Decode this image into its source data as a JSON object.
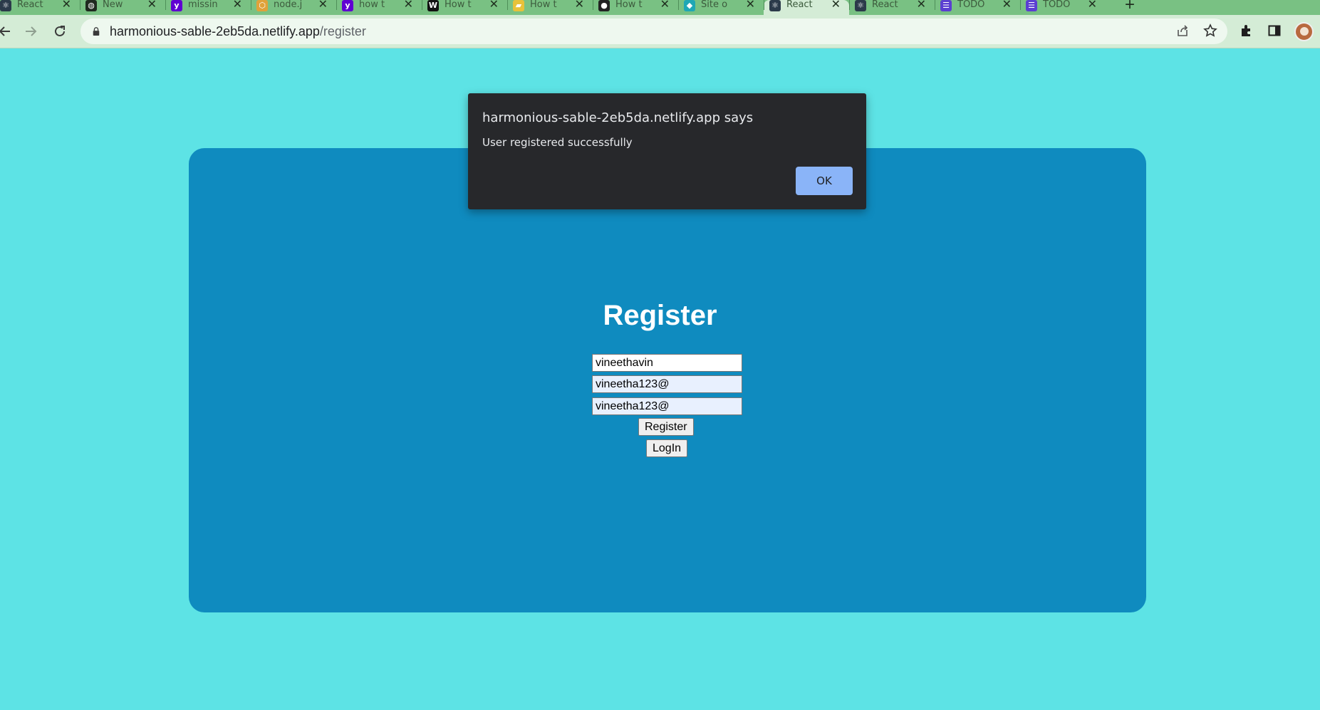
{
  "browser": {
    "tabs": [
      {
        "title": "React",
        "icon": "react-favicon",
        "color": "#2b3a4a",
        "glyph": "⚛"
      },
      {
        "title": "New",
        "icon": "globe-favicon",
        "color": "#1f2a1f",
        "glyph": "◍"
      },
      {
        "title": "missin",
        "icon": "yahoo-favicon",
        "color": "#6001d2",
        "glyph": "y"
      },
      {
        "title": "node.j",
        "icon": "node-favicon",
        "color": "#e0a23a",
        "glyph": "⬡"
      },
      {
        "title": "how t",
        "icon": "yahoo-favicon",
        "color": "#6001d2",
        "glyph": "y"
      },
      {
        "title": "How t",
        "icon": "code-favicon",
        "color": "#111111",
        "glyph": "W"
      },
      {
        "title": "How t",
        "icon": "folder-favicon",
        "color": "#e7c23a",
        "glyph": "▰"
      },
      {
        "title": "How t",
        "icon": "github-favicon",
        "color": "#222222",
        "glyph": "●"
      },
      {
        "title": "Site o",
        "icon": "netlify-favicon",
        "color": "#1fa7b5",
        "glyph": "◆"
      },
      {
        "title": "React",
        "icon": "react-favicon",
        "color": "#2b3a4a",
        "glyph": "⚛",
        "active": true
      },
      {
        "title": "React",
        "icon": "react-favicon",
        "color": "#2b3a4a",
        "glyph": "⚛"
      },
      {
        "title": "TODO",
        "icon": "todo-favicon",
        "color": "#5b3fd1",
        "glyph": "☰"
      },
      {
        "title": "TODO",
        "icon": "todo-favicon",
        "color": "#5b3fd1",
        "glyph": "☰"
      }
    ],
    "close_glyph": "✕",
    "new_tab_glyph": "+",
    "url_host": "harmonious-sable-2eb5da.netlify.app",
    "url_path": "/register"
  },
  "page": {
    "title": "Register",
    "fields": [
      {
        "value": "vineethavin"
      },
      {
        "value": "vineetha123@"
      },
      {
        "value": "vineetha123@"
      }
    ],
    "register_button": "Register",
    "login_button": "LogIn"
  },
  "dialog": {
    "title": "harmonious-sable-2eb5da.netlify.app says",
    "message": "User registered successfully",
    "ok": "OK"
  },
  "colors": {
    "page_bg": "#5de3e5",
    "card_bg": "#0f8bbf",
    "tabstrip_bg": "#79c183",
    "toolbar_bg": "#d4ecd6",
    "dialog_bg": "#27282b",
    "dialog_button": "#8ab4f8"
  }
}
